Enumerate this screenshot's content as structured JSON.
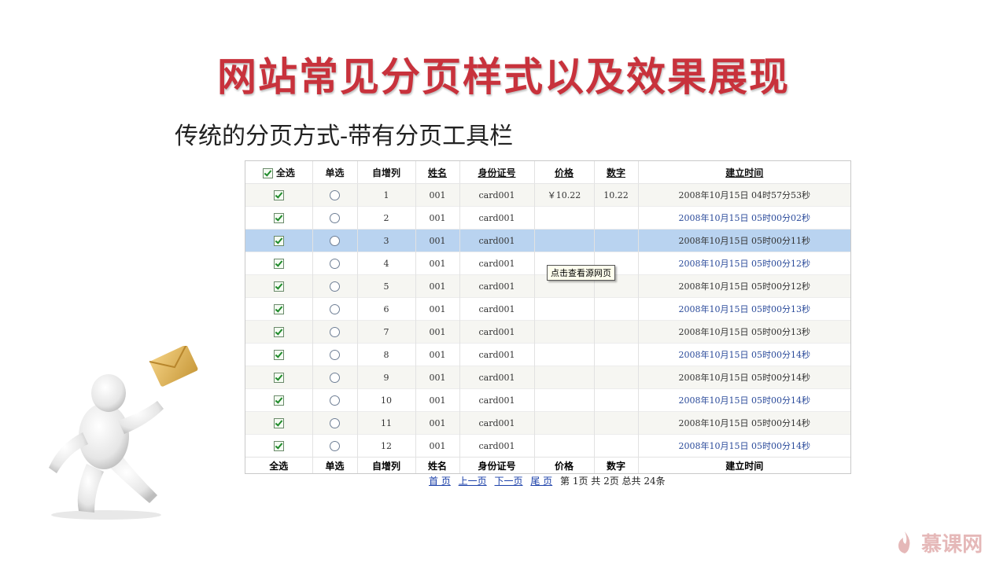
{
  "slide": {
    "title": "网站常见分页样式以及效果展现",
    "subtitle": "传统的分页方式-带有分页工具栏"
  },
  "table": {
    "header": {
      "select_all": "全选",
      "single": "单选",
      "auto_inc": "自增列",
      "name": "姓名",
      "id_card": "身份证号",
      "price": "价格",
      "number": "数字",
      "created": "建立时间"
    },
    "footer": {
      "select_all": "全选",
      "single": "单选",
      "auto_inc": "自增列",
      "name": "姓名",
      "id_card": "身份证号",
      "price": "价格",
      "number": "数字",
      "created": "建立时间"
    },
    "selected_row_index": 2,
    "rows": [
      {
        "id": "1",
        "name": "001",
        "card": "card001",
        "price": "￥10.22",
        "number": "10.22",
        "time": "2008年10月15日  04时57分53秒"
      },
      {
        "id": "2",
        "name": "001",
        "card": "card001",
        "price": "",
        "number": "",
        "time": "2008年10月15日  05时00分02秒"
      },
      {
        "id": "3",
        "name": "001",
        "card": "card001",
        "price": "",
        "number": "",
        "time": "2008年10月15日  05时00分11秒"
      },
      {
        "id": "4",
        "name": "001",
        "card": "card001",
        "price": "",
        "number": "",
        "time": "2008年10月15日  05时00分12秒"
      },
      {
        "id": "5",
        "name": "001",
        "card": "card001",
        "price": "",
        "number": "",
        "time": "2008年10月15日  05时00分12秒"
      },
      {
        "id": "6",
        "name": "001",
        "card": "card001",
        "price": "",
        "number": "",
        "time": "2008年10月15日  05时00分13秒"
      },
      {
        "id": "7",
        "name": "001",
        "card": "card001",
        "price": "",
        "number": "",
        "time": "2008年10月15日  05时00分13秒"
      },
      {
        "id": "8",
        "name": "001",
        "card": "card001",
        "price": "",
        "number": "",
        "time": "2008年10月15日  05时00分14秒"
      },
      {
        "id": "9",
        "name": "001",
        "card": "card001",
        "price": "",
        "number": "",
        "time": "2008年10月15日  05时00分14秒"
      },
      {
        "id": "10",
        "name": "001",
        "card": "card001",
        "price": "",
        "number": "",
        "time": "2008年10月15日  05时00分14秒"
      },
      {
        "id": "11",
        "name": "001",
        "card": "card001",
        "price": "",
        "number": "",
        "time": "2008年10月15日  05时00分14秒"
      },
      {
        "id": "12",
        "name": "001",
        "card": "card001",
        "price": "",
        "number": "",
        "time": "2008年10月15日  05时00分14秒"
      }
    ]
  },
  "tooltip": "点击查看源网页",
  "pager": {
    "first": "首 页",
    "prev": "上一页",
    "next": "下一页",
    "last": "尾 页",
    "status": "第 1页 共 2页 总共 24条"
  },
  "watermark": "慕课网",
  "colors": {
    "title": "#c8323c",
    "selected_row": "#b9d3f0",
    "link": "#1a3fa8"
  },
  "icons": [
    "checkbox-checked-icon",
    "radio-icon",
    "envelope-icon",
    "flame-logo-icon"
  ]
}
